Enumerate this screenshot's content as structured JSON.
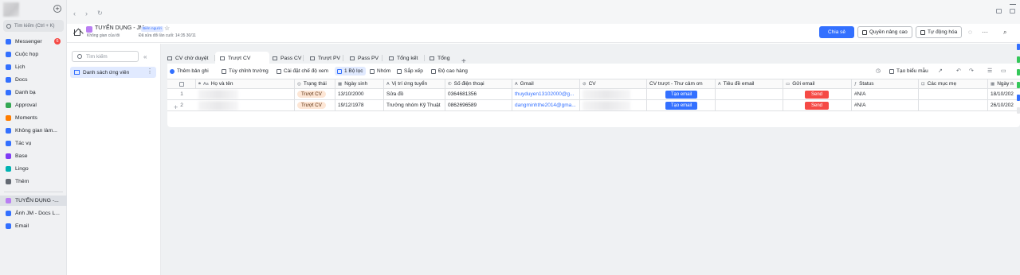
{
  "sidebar": {
    "search_placeholder": "Tìm kiếm (Ctrl + K)",
    "items": [
      {
        "label": "Messenger",
        "icon": "chat-icon",
        "color": "#3370ff"
      },
      {
        "label": "Cuộc họp",
        "icon": "camera-icon",
        "color": "#3370ff"
      },
      {
        "label": "Lịch",
        "icon": "calendar-icon",
        "color": "#3370ff"
      },
      {
        "label": "Docs",
        "icon": "docs-icon",
        "color": "#3370ff"
      },
      {
        "label": "Danh bạ",
        "icon": "contacts-icon",
        "color": "#3370ff"
      },
      {
        "label": "Approval",
        "icon": "approval-icon",
        "color": "#34a853"
      },
      {
        "label": "Moments",
        "icon": "moments-icon",
        "color": "#ff7d00"
      },
      {
        "label": "Không gian làm...",
        "icon": "workspace-icon",
        "color": "#3370ff"
      },
      {
        "label": "Tác vụ",
        "icon": "task-icon",
        "color": "#3370ff"
      },
      {
        "label": "Base",
        "icon": "base-icon",
        "color": "#7f3bf5"
      },
      {
        "label": "Lingo",
        "icon": "lingo-icon",
        "color": "#00b2b2"
      },
      {
        "label": "Thêm",
        "icon": "grid-icon",
        "color": "#646a73"
      }
    ],
    "messenger_badge": "6",
    "pinned": [
      {
        "label": "TUYỂN DỤNG -...",
        "icon": "base-doc-icon",
        "color": "#b97ef3",
        "active": true
      },
      {
        "label": "Ảnh JM - Docs L...",
        "icon": "docs-icon",
        "color": "#3370ff"
      },
      {
        "label": "Email",
        "icon": "mail-icon",
        "color": "#3370ff"
      }
    ]
  },
  "doc_header": {
    "title": "TUYỂN DỤNG - JM",
    "edit_tag": "Biên người",
    "workspace": "Không gian của tôi",
    "last_edited": "Đã sửa đổi lần cuối: 14:35 30/11",
    "share_label": "Chia sẻ",
    "advanced_label": "Quyền nâng cao",
    "automation_label": "Tự động hóa"
  },
  "base_sidebar": {
    "search_placeholder": "Tìm kiếm",
    "table_name": "Danh sách ứng viên"
  },
  "tabs": [
    {
      "label": "CV chờ duyệt"
    },
    {
      "label": "Trượt CV",
      "active": true
    },
    {
      "label": "Pass CV"
    },
    {
      "label": "Trượt PV"
    },
    {
      "label": "Pass PV"
    },
    {
      "label": "Tổng kết"
    },
    {
      "label": "Tổng"
    }
  ],
  "toolbar": {
    "add_record": "Thêm bản ghi",
    "customize_fields": "Tùy chỉnh trường",
    "view_settings": "Cài đặt chế độ xem",
    "filter": "1 Bộ lọc",
    "group": "Nhóm",
    "sort": "Sắp xếp",
    "row_height": "Độ cao hàng",
    "create_form": "Tạo biểu mẫu"
  },
  "table": {
    "columns": [
      {
        "label": "Họ và tên",
        "icon": "Aa"
      },
      {
        "label": "Trạng thái",
        "icon": "◎"
      },
      {
        "label": "Ngày sinh",
        "icon": "▦"
      },
      {
        "label": "Vị trí ứng tuyển",
        "icon": "A"
      },
      {
        "label": "Số điện thoại",
        "icon": "✆"
      },
      {
        "label": "Gmail",
        "icon": "A"
      },
      {
        "label": "CV",
        "icon": "⊘"
      },
      {
        "label": "CV trượt - Thư cảm ơn",
        "icon": ""
      },
      {
        "label": "Tiêu đề email",
        "icon": "A"
      },
      {
        "label": "Gửi email",
        "icon": "▭"
      },
      {
        "label": "Status",
        "icon": "ƒ"
      },
      {
        "label": "Các mục mẹ",
        "icon": "⊡"
      },
      {
        "label": "Ngày n",
        "icon": "▦"
      }
    ],
    "rows": [
      {
        "num": "1",
        "status": "Trượt CV",
        "dob": "13/10/2000",
        "position": "Sửa đồ",
        "phone": "0364681356",
        "gmail": "thuyduyen13102000@g...",
        "cv_button": "Tạo email",
        "send_button": "Send",
        "status_formula": "#N/A",
        "date": "18/10/202"
      },
      {
        "num": "2",
        "status": "Trượt CV",
        "dob": "19/12/1978",
        "position": "Trưởng nhóm Kỹ Thuật",
        "phone": "0862696589",
        "gmail": "dangminhthe2014@gma...",
        "cv_button": "Tạo email",
        "send_button": "Send",
        "status_formula": "#N/A",
        "date": "26/10/202"
      }
    ]
  },
  "colors": {
    "accent": "#3370ff",
    "danger": "#f54a45",
    "status_pill_bg": "#fde6d5"
  }
}
